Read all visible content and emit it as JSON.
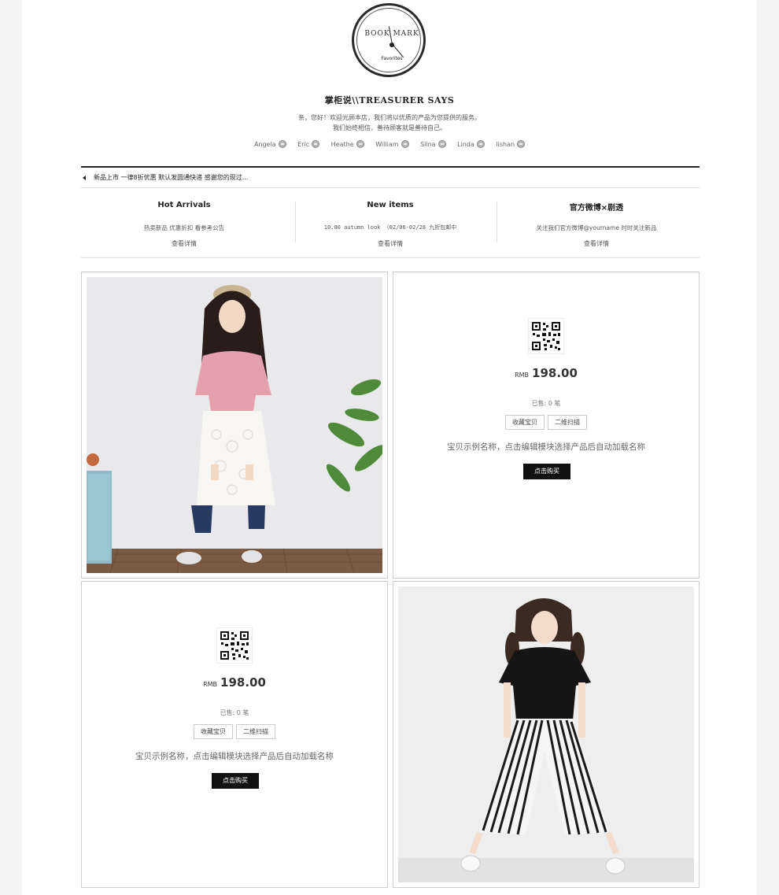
{
  "brand": {
    "logo_text": "BOOK MARK",
    "logo_subtext": "Favorites"
  },
  "header": {
    "title": "掌柜说\\\\TREASURER SAYS",
    "intro_line1": "亲，您好！欢迎光顾本店，我们将以优质的产品为您提供的服务。",
    "intro_line2": "我们始终相信，善待顾客就是善待自己。"
  },
  "staff": [
    {
      "name": "Angela",
      "icon": "qq-icon"
    },
    {
      "name": "Eric",
      "icon": "qq-icon"
    },
    {
      "name": "Heathe",
      "icon": "qq-icon"
    },
    {
      "name": "William",
      "icon": "qq-icon"
    },
    {
      "name": "Siina",
      "icon": "qq-icon"
    },
    {
      "name": "Linda",
      "icon": "qq-icon"
    },
    {
      "name": "lishan",
      "icon": "qq-icon"
    }
  ],
  "notice": {
    "text": "新品上市 一律8折优惠 默认发圆通快递 感谢您的现过..."
  },
  "info": [
    {
      "heading": "Hot Arrivals",
      "desc": "热卖新品 优惠折扣 看参考公告",
      "link": "查看详情"
    },
    {
      "heading": "New items",
      "desc": "10.00 autumn look （02/06-02/28 九折包邮中",
      "link": "查看详情"
    },
    {
      "heading": "官方微博×剧透",
      "desc": "关注我们官方微博@yourname 时时关注新品",
      "link": "查看详情"
    }
  ],
  "products": [
    {
      "currency": "RMB",
      "price": "198.00",
      "sold": "已售: 0 笔",
      "fav_label": "收藏宝贝",
      "qr_label": "二维扫描",
      "name": "宝贝示例名称，点击编辑模块选择产品后自动加载名称",
      "buy_label": "点击购买"
    },
    {
      "currency": "RMB",
      "price": "198.00",
      "sold": "已售: 0 笔",
      "fav_label": "收藏宝贝",
      "qr_label": "二维扫描",
      "name": "宝贝示例名称，点击编辑模块选择产品后自动加载名称",
      "buy_label": "点击购买"
    }
  ],
  "colors": {
    "accent": "#111111",
    "page_bg": "#ffffff",
    "outer_bg": "#f4f4f4"
  }
}
